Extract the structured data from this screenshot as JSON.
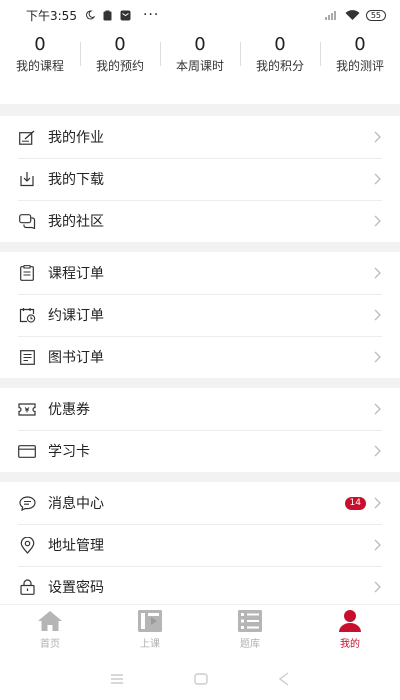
{
  "status_bar": {
    "time": "下午3:55",
    "battery": "55"
  },
  "stats": [
    {
      "value": "0",
      "label": "我的课程"
    },
    {
      "value": "0",
      "label": "我的预约"
    },
    {
      "value": "0",
      "label": "本周课时"
    },
    {
      "value": "0",
      "label": "我的积分"
    },
    {
      "value": "0",
      "label": "我的测评"
    }
  ],
  "menu": {
    "group1": [
      {
        "label": "我的作业",
        "icon": "homework-icon"
      },
      {
        "label": "我的下载",
        "icon": "download-icon"
      },
      {
        "label": "我的社区",
        "icon": "community-icon"
      }
    ],
    "group2": [
      {
        "label": "课程订单",
        "icon": "clipboard-icon"
      },
      {
        "label": "约课订单",
        "icon": "calendar-clock-icon"
      },
      {
        "label": "图书订单",
        "icon": "book-order-icon"
      }
    ],
    "group3": [
      {
        "label": "优惠券",
        "icon": "coupon-icon"
      },
      {
        "label": "学习卡",
        "icon": "card-icon"
      }
    ],
    "group4": [
      {
        "label": "消息中心",
        "icon": "message-icon",
        "badge": "14"
      },
      {
        "label": "地址管理",
        "icon": "location-icon"
      },
      {
        "label": "设置密码",
        "icon": "lock-icon"
      }
    ]
  },
  "tabbar": [
    {
      "label": "首页",
      "icon": "home-icon",
      "active": false
    },
    {
      "label": "上课",
      "icon": "class-icon",
      "active": false
    },
    {
      "label": "题库",
      "icon": "question-bank-icon",
      "active": false
    },
    {
      "label": "我的",
      "icon": "profile-icon",
      "active": true
    }
  ],
  "colors": {
    "accent": "#c8102e",
    "inactive": "#b0b0b0",
    "separator": "#f2f2f2"
  }
}
